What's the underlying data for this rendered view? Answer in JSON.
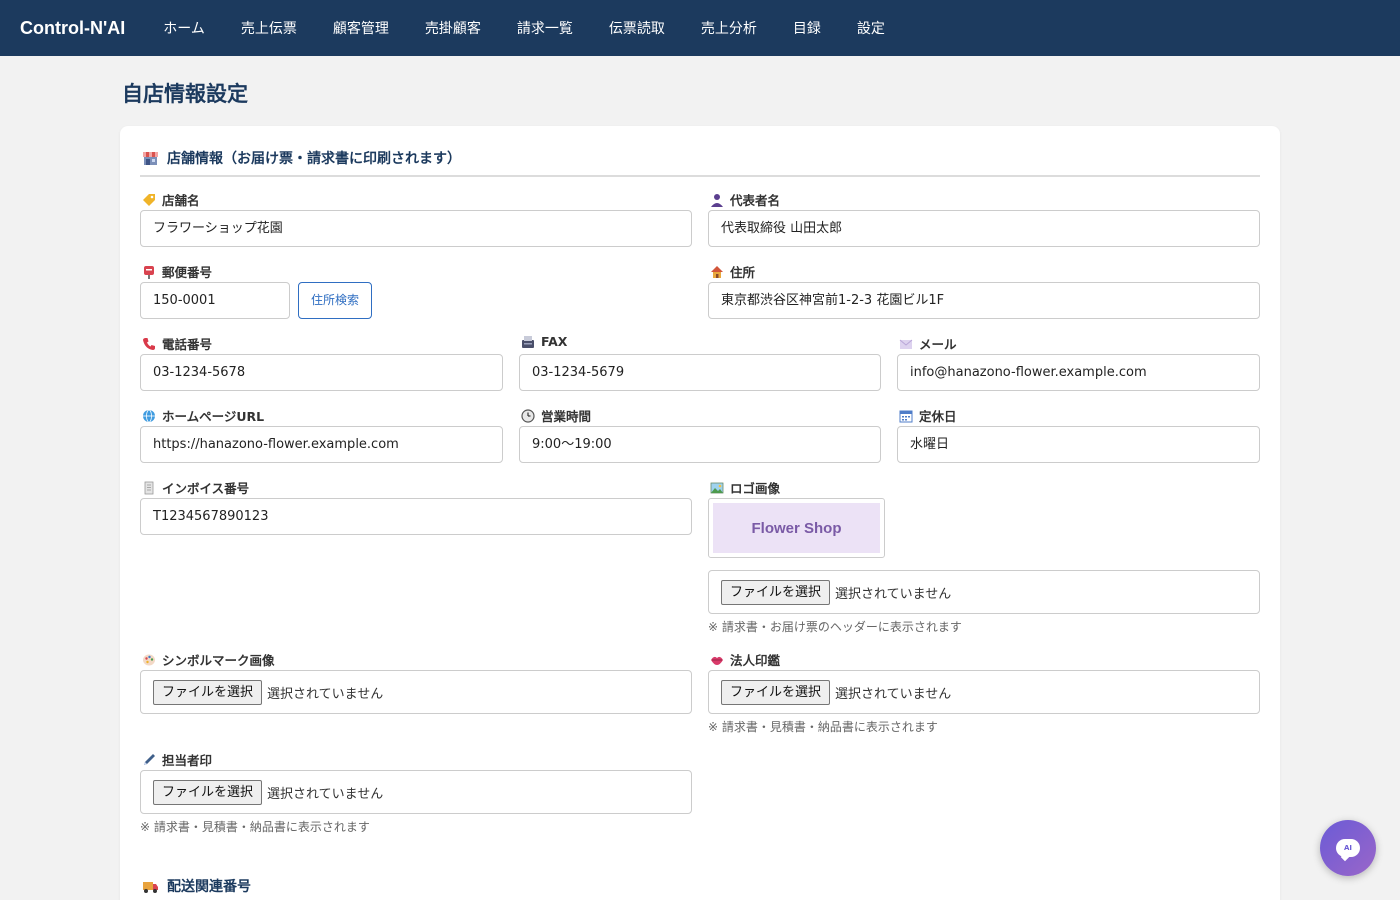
{
  "app": {
    "title": "Control-N'AI"
  },
  "nav": {
    "items": [
      "ホーム",
      "売上伝票",
      "顧客管理",
      "売掛顧客",
      "請求一覧",
      "伝票読取",
      "売上分析",
      "目録",
      "設定"
    ]
  },
  "page": {
    "title": "自店情報設定"
  },
  "store_section": {
    "title": "店舗情報（お届け票・請求書に印刷されます）",
    "store_name": {
      "label": "店舗名",
      "value": "フラワーショップ花園"
    },
    "representative": {
      "label": "代表者名",
      "value": "代表取締役 山田太郎"
    },
    "postal": {
      "label": "郵便番号",
      "value": "150-0001",
      "search_button": "住所検索"
    },
    "address": {
      "label": "住所",
      "value": "東京都渋谷区神宮前1-2-3 花園ビル1F"
    },
    "phone": {
      "label": "電話番号",
      "value": "03-1234-5678"
    },
    "fax": {
      "label": "FAX",
      "value": "03-1234-5679"
    },
    "email": {
      "label": "メール",
      "value": "info@hanazono-flower.example.com"
    },
    "homepage": {
      "label": "ホームページURL",
      "value": "https://hanazono-flower.example.com"
    },
    "hours": {
      "label": "営業時間",
      "value": "9:00〜19:00"
    },
    "holiday": {
      "label": "定休日",
      "value": "水曜日"
    },
    "invoice": {
      "label": "インボイス番号",
      "value": "T1234567890123"
    },
    "logo": {
      "label": "ロゴ画像",
      "preview_text": "Flower Shop",
      "file_button": "ファイルを選択",
      "file_status": "選択されていません",
      "note": "※ 請求書・お届け票のヘッダーに表示されます"
    },
    "symbol": {
      "label": "シンボルマーク画像",
      "file_button": "ファイルを選択",
      "file_status": "選択されていません"
    },
    "corporate_seal": {
      "label": "法人印鑑",
      "file_button": "ファイルを選択",
      "file_status": "選択されていません",
      "note": "※ 請求書・見積書・納品書に表示されます"
    },
    "staff_seal": {
      "label": "担当者印",
      "file_button": "ファイルを選択",
      "file_status": "選択されていません",
      "note": "※ 請求書・見積書・納品書に表示されます"
    }
  },
  "delivery_section": {
    "title": "配送関連番号"
  },
  "chat": {
    "badge": "AI"
  },
  "colors": {
    "navbar": "#1c3a5e",
    "accent": "#2f6ec2",
    "chat_gradient_start": "#6b5bd6",
    "chat_gradient_end": "#9a66c9"
  }
}
